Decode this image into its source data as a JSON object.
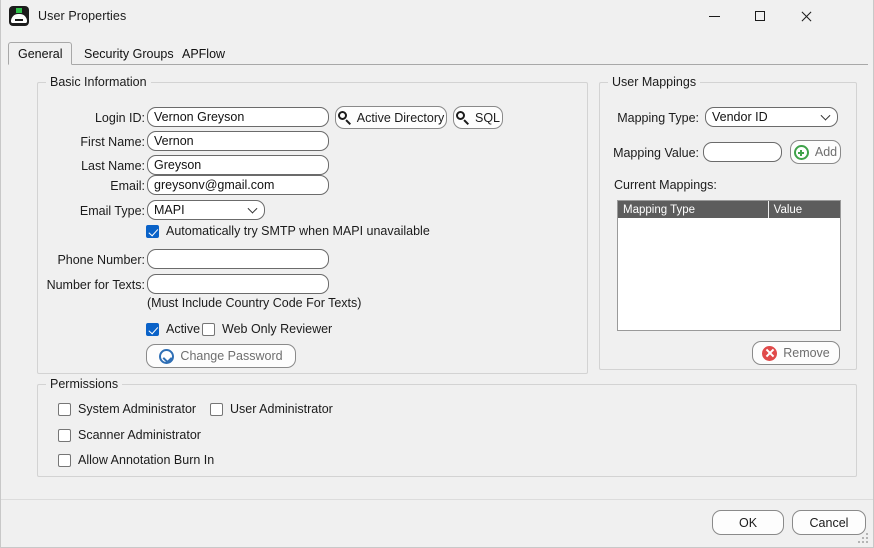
{
  "window": {
    "title": "User Properties",
    "app_icon": "scanner-app-icon",
    "controls": {
      "minimize": "minimize-icon",
      "maximize": "maximize-icon",
      "close": "close-icon"
    }
  },
  "tabs": [
    {
      "label": "General",
      "active": true
    },
    {
      "label": "Security Groups",
      "active": false
    },
    {
      "label": "APFlow",
      "active": false
    }
  ],
  "basic_information": {
    "legend": "Basic Information",
    "fields": {
      "login_id": {
        "label": "Login ID:",
        "value": "Vernon Greyson"
      },
      "first_name": {
        "label": "First Name:",
        "value": "Vernon"
      },
      "last_name": {
        "label": "Last Name:",
        "value": "Greyson"
      },
      "email": {
        "label": "Email:",
        "value": "greysonv@gmail.com"
      },
      "email_type": {
        "label": "Email Type:",
        "value": "MAPI"
      },
      "phone_number": {
        "label": "Phone Number:",
        "value": ""
      },
      "number_for_texts": {
        "label": "Number for Texts:",
        "value": ""
      }
    },
    "buttons": {
      "active_directory": "Active Directory",
      "sql": "SQL",
      "change_password": "Change Password"
    },
    "checkboxes": {
      "auto_smtp": {
        "label": "Automatically try SMTP when MAPI unavailable",
        "checked": true
      },
      "active": {
        "label": "Active",
        "checked": true
      },
      "web_only_reviewer": {
        "label": "Web Only Reviewer",
        "checked": false
      }
    },
    "hint": "(Must Include Country Code For Texts)"
  },
  "user_mappings": {
    "legend": "User Mappings",
    "mapping_type": {
      "label": "Mapping Type:",
      "value": "Vendor ID"
    },
    "mapping_value": {
      "label": "Mapping Value:",
      "value": "",
      "placeholder": ""
    },
    "add_button": "Add",
    "current_mappings_label": "Current Mappings:",
    "list": {
      "columns": [
        "Mapping Type",
        "Value"
      ],
      "rows": []
    },
    "remove_button": "Remove"
  },
  "permissions": {
    "legend": "Permissions",
    "items": [
      {
        "label": "System Administrator",
        "checked": false
      },
      {
        "label": "User Administrator",
        "checked": false
      },
      {
        "label": "Scanner Administrator",
        "checked": false
      },
      {
        "label": "Allow Annotation Burn In",
        "checked": false
      }
    ]
  },
  "footer": {
    "ok": "OK",
    "cancel": "Cancel"
  },
  "colors": {
    "accent_checked": "#0a62c8",
    "list_header_bg": "#5d5d5d",
    "add_green": "#3fa24a",
    "remove_red": "#e04a4a",
    "window_bg": "#f0f0f0"
  }
}
